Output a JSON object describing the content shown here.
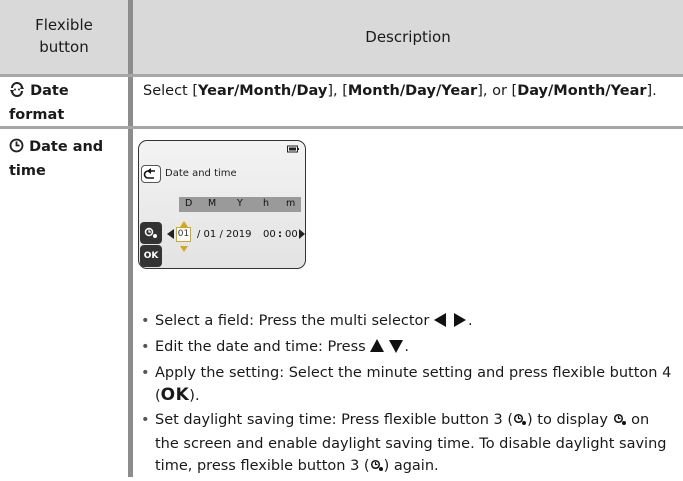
{
  "header": {
    "col1": [
      "Flexible",
      "button"
    ],
    "col2": "Description"
  },
  "rows": [
    {
      "label_word1": "Date",
      "label_word2": "format",
      "icon": "date-format-icon",
      "desc": {
        "p1": "Select [",
        "b1": "Year/Month/Day",
        "p2": "], [",
        "b2": "Month/Day/Year",
        "p3": "], or [",
        "b3": "Day/Month/Year",
        "p4": "]."
      }
    },
    {
      "label_word1": "Date and",
      "label_word2": "time",
      "icon": "clock-icon",
      "screen": {
        "title": "Date and time",
        "labels": [
          "D",
          "M",
          "Y",
          "h",
          "m"
        ],
        "value_day": "01",
        "value_rest": "/ 01 / 2019",
        "value_time_h": "00",
        "value_sep": ":",
        "value_time_m": "00",
        "ok": "OK"
      },
      "bullets": {
        "b1": "Select a field: Press the multi selector",
        "b2": "Edit the date and time: Press",
        "b3_text": "Apply the setting: Select the minute setting and press flexible button 4 (",
        "b3_ok": "OK",
        "b3_end": ").",
        "b4_a": "Set daylight saving time: Press flexible button 3 (",
        "b4_b": ") to display",
        "b4_c": "on the screen and enable daylight saving time. To disable daylight saving time, press flexible button 3 (",
        "b4_d": ") again."
      }
    }
  ],
  "colors": {
    "header_bg": "#d9d9d9",
    "rule": "#8c8c8c",
    "accent": "#d4a81b"
  }
}
